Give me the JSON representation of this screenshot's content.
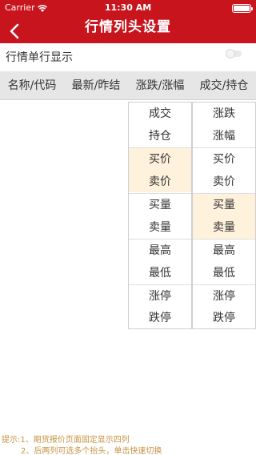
{
  "status": {
    "carrier": "Carrier",
    "time": "11:30 AM"
  },
  "nav": {
    "title": "行情列头设置"
  },
  "setting": {
    "single_line_label": "行情单行显示",
    "single_line_enabled": false
  },
  "columns": [
    "名称/代码",
    "最新/昨结",
    "涨跌/涨幅",
    "成交/持仓"
  ],
  "dropdown_a": {
    "items": [
      "成交",
      "持仓",
      "买价",
      "卖价",
      "买量",
      "卖量",
      "最高",
      "最低",
      "涨停",
      "跌停"
    ],
    "highlighted_pair": 1
  },
  "dropdown_b": {
    "items": [
      "涨跌",
      "涨幅",
      "买价",
      "卖价",
      "买量",
      "卖量",
      "最高",
      "最低",
      "涨停",
      "跌停"
    ],
    "highlighted_pair": 2
  },
  "tips": {
    "line1": "提示:1、期货报价页面固定显示四列",
    "line2": "2、后两列可选多个抬头，单击快速切换"
  },
  "colors": {
    "brand_red": "#c8141d",
    "highlight": "#fff2dd",
    "tip_text": "#c89343"
  }
}
